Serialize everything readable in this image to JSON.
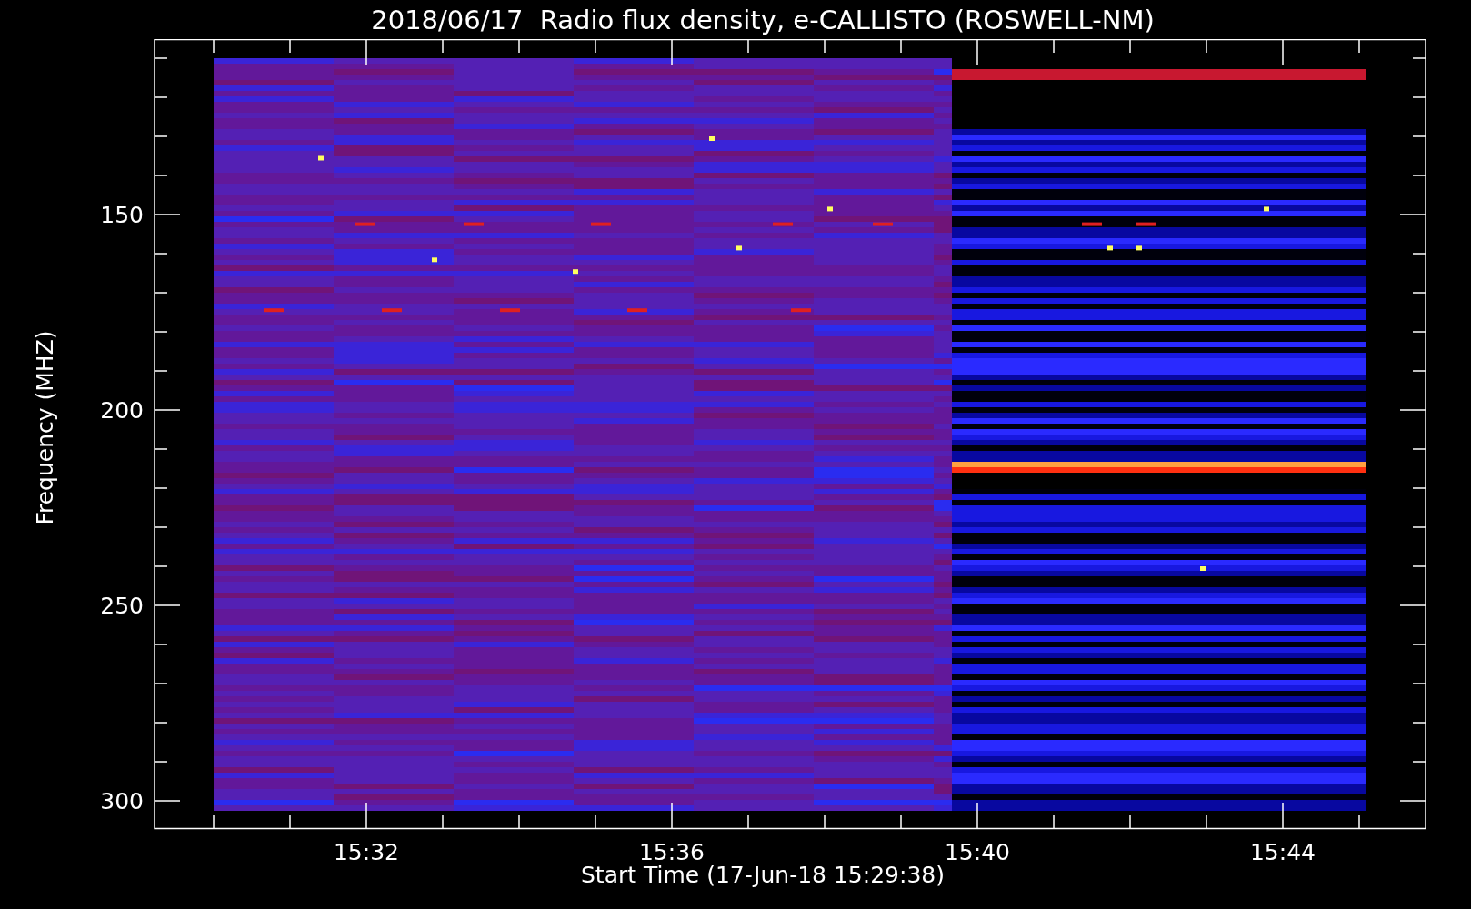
{
  "title": "2018/06/17  Radio flux density, e-CALLISTO (ROSWELL-NM)",
  "y_axis": {
    "label": "Frequency (MHZ)",
    "ticks": [
      "150",
      "200",
      "250",
      "300"
    ]
  },
  "x_axis": {
    "label": "Start Time (17-Jun-18 15:29:38)",
    "ticks": [
      "15:32",
      "15:36",
      "15:40",
      "15:44"
    ]
  }
}
